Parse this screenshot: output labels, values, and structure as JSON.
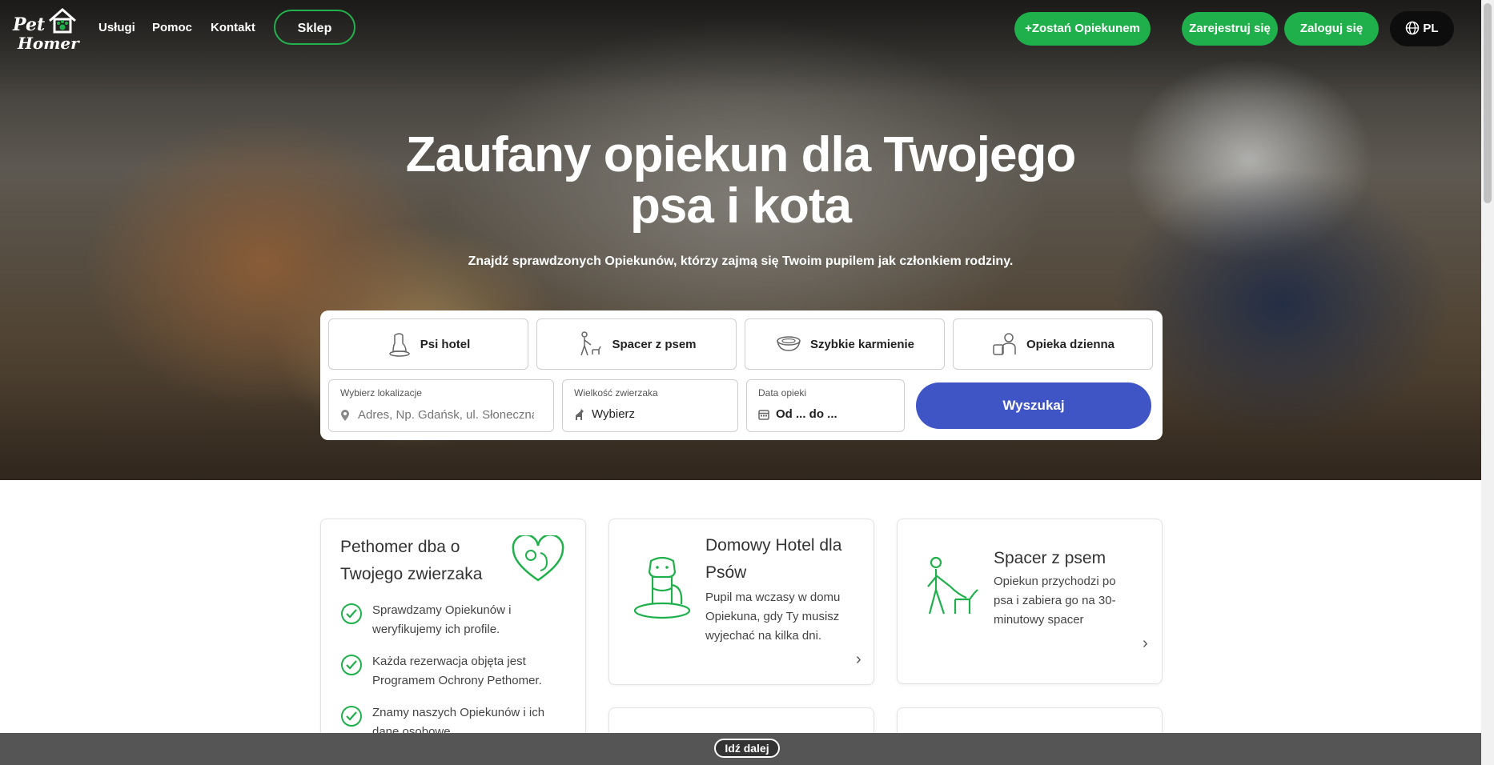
{
  "nav": {
    "logo_line1": "Pet",
    "logo_line2": "Homer",
    "links": [
      "Usługi",
      "Pomoc",
      "Kontakt"
    ],
    "shop": "Sklep",
    "become_sitter": "+Zostań Opiekunem",
    "register": "Zarejestruj się",
    "login": "Zaloguj się",
    "lang": "PL"
  },
  "hero": {
    "title_line1": "Zaufany opiekun dla Twojego",
    "title_line2": "psa i kota",
    "subtitle": "Znajdź sprawdzonych Opiekunów, którzy zajmą się Twoim pupilem jak członkiem rodziny."
  },
  "search": {
    "services": [
      "Psi hotel",
      "Spacer z psem",
      "Szybkie karmienie",
      "Opieka dzienna"
    ],
    "location_label": "Wybierz lokalizacje",
    "location_placeholder": "Adres, Np. Gdańsk, ul. Słoneczna",
    "size_label": "Wielkość zwierzaka",
    "size_value": "Wybierz",
    "date_label": "Data opieki",
    "date_value": "Od ... do ...",
    "submit": "Wyszukaj"
  },
  "cards": {
    "care": {
      "title_line1": "Pethomer dba o",
      "title_line2": "Twojego zwierzaka",
      "items": [
        [
          "Sprawdzamy Opiekunów i",
          "weryfikujemy ich profile."
        ],
        [
          "Każda rezerwacja objęta jest",
          "Programem Ochrony Pethomer."
        ],
        [
          "Znamy naszych Opiekunów i ich",
          "dane osobowe."
        ]
      ]
    },
    "hotel": {
      "title_line1": "Domowy Hotel dla",
      "title_line2": "Psów",
      "desc": [
        "Pupil ma wczasy w domu",
        "Opiekuna, gdy Ty musisz",
        "wyjechać na kilka dni."
      ]
    },
    "walk": {
      "title": "Spacer z psem",
      "desc": [
        "Opiekun przychodzi po",
        "psa i zabiera go na 30-",
        "minutowy spacer"
      ]
    }
  },
  "bottom": {
    "next": "Idź dalej"
  },
  "colors": {
    "green": "#1fb04b",
    "blue": "#3f55c6",
    "dark": "#0d0d0d"
  }
}
